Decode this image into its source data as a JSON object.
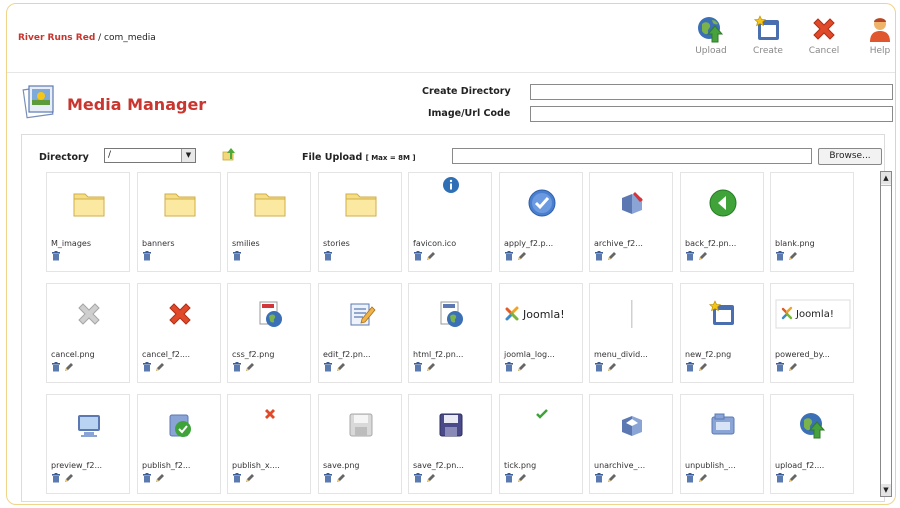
{
  "breadcrumb": {
    "site": "River Runs Red",
    "separator": " / ",
    "component": "com_media"
  },
  "toolbar": [
    {
      "label": "Upload",
      "icon": "upload-icon"
    },
    {
      "label": "Create",
      "icon": "create-icon"
    },
    {
      "label": "Cancel",
      "icon": "cancel-icon"
    },
    {
      "label": "Help",
      "icon": "help-icon"
    }
  ],
  "page": {
    "title": "Media Manager"
  },
  "form": {
    "create_directory_label": "Create Directory",
    "image_url_code_label": "Image/Url Code",
    "directory_label": "Directory",
    "directory_value": "/",
    "file_upload_label": "File Upload",
    "file_upload_max": "[ Max = 8M ]",
    "browse_label": "Browse..."
  },
  "files": [
    {
      "name": "M_images",
      "icon": "folder-icon",
      "type": "folder"
    },
    {
      "name": "banners",
      "icon": "folder-icon",
      "type": "folder"
    },
    {
      "name": "smilies",
      "icon": "folder-icon",
      "type": "folder"
    },
    {
      "name": "stories",
      "icon": "folder-icon",
      "type": "folder"
    },
    {
      "name": "favicon.ico",
      "icon": "info-icon",
      "type": "file"
    },
    {
      "name": "apply_f2.p...",
      "icon": "apply-icon",
      "type": "file"
    },
    {
      "name": "archive_f2...",
      "icon": "archive-icon",
      "type": "file"
    },
    {
      "name": "back_f2.pn...",
      "icon": "back-icon",
      "type": "file"
    },
    {
      "name": "blank.png",
      "icon": "blank-icon",
      "type": "file"
    },
    {
      "name": "cancel.png",
      "icon": "cancel-gray-icon",
      "type": "file"
    },
    {
      "name": "cancel_f2....",
      "icon": "cancel-red-icon",
      "type": "file"
    },
    {
      "name": "css_f2.png",
      "icon": "css-icon",
      "type": "file"
    },
    {
      "name": "edit_f2.pn...",
      "icon": "edit-icon",
      "type": "file"
    },
    {
      "name": "html_f2.pn...",
      "icon": "html-icon",
      "type": "file"
    },
    {
      "name": "joomla_log...",
      "icon": "joomla-logo-icon",
      "type": "file",
      "logo_text": "Joomla!"
    },
    {
      "name": "menu_divid...",
      "icon": "menu-divider-icon",
      "type": "file"
    },
    {
      "name": "new_f2.png",
      "icon": "new-icon",
      "type": "file"
    },
    {
      "name": "powered_by...",
      "icon": "powered-by-icon",
      "type": "file",
      "logo_text": "Joomla!"
    },
    {
      "name": "preview_f2...",
      "icon": "preview-icon",
      "type": "file"
    },
    {
      "name": "publish_f2...",
      "icon": "publish-icon",
      "type": "file"
    },
    {
      "name": "publish_x....",
      "icon": "publish-x-icon",
      "type": "file"
    },
    {
      "name": "save.png",
      "icon": "save-gray-icon",
      "type": "file"
    },
    {
      "name": "save_f2.pn...",
      "icon": "save-icon",
      "type": "file"
    },
    {
      "name": "tick.png",
      "icon": "tick-icon",
      "type": "file"
    },
    {
      "name": "unarchive_...",
      "icon": "unarchive-icon",
      "type": "file"
    },
    {
      "name": "unpublish_...",
      "icon": "unpublish-icon",
      "type": "file"
    },
    {
      "name": "upload_f2....",
      "icon": "upload-globe-icon",
      "type": "file"
    }
  ],
  "colors": {
    "brand": "#c8362f",
    "frame_border": "#f0d48a"
  }
}
